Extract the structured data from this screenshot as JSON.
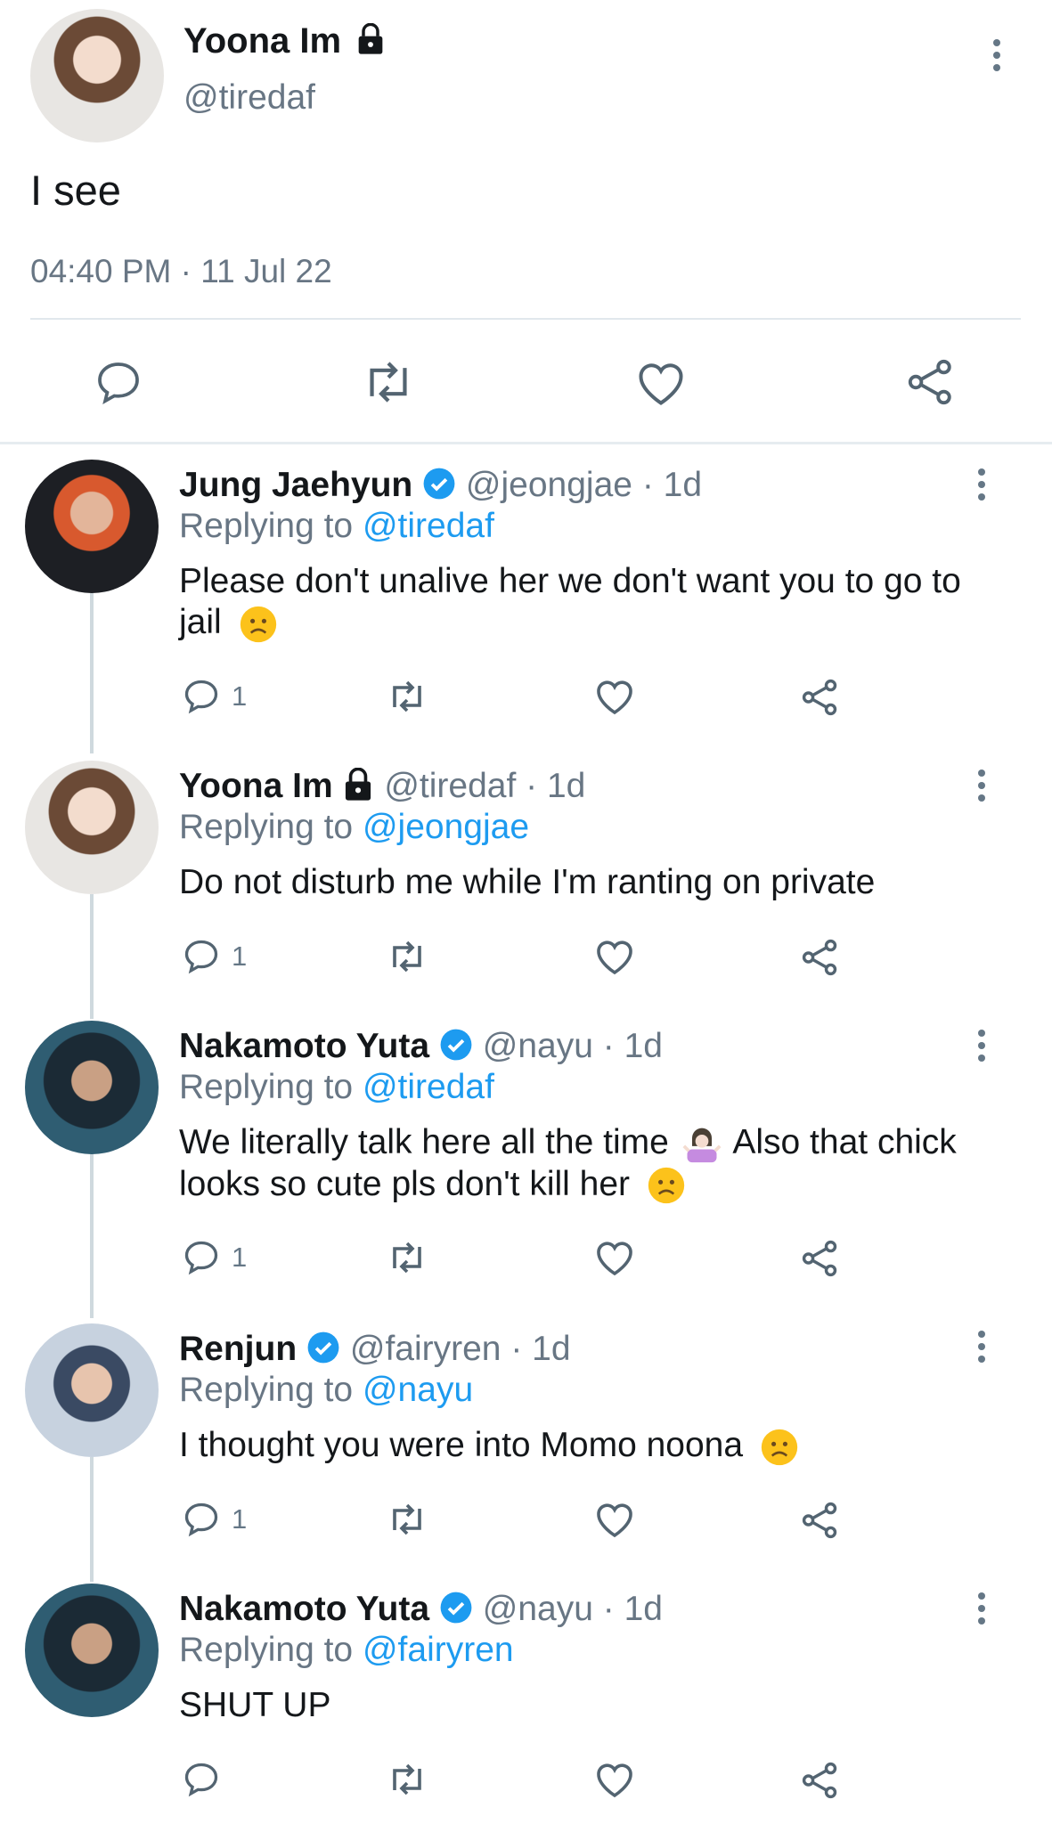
{
  "main_tweet": {
    "name": "Yoona Im",
    "handle": "@tiredaf",
    "text": "I see",
    "timestamp": "04:40 PM · 11 Jul 22",
    "locked": true
  },
  "replies": [
    {
      "name": "Jung Jaehyun",
      "verified": true,
      "handle": "@jeongjae",
      "time": "· 1d",
      "replying_label": "Replying to",
      "replying_to": "@tiredaf",
      "text_line1": "Please don't unalive her we don't want you to go to",
      "text_line2": "jail",
      "reply_count": "1"
    },
    {
      "name": "Yoona Im",
      "locked": true,
      "handle": "@tiredaf",
      "time": "· 1d",
      "replying_label": "Replying to",
      "replying_to": "@jeongjae",
      "text_line1": "Do not disturb me while I'm ranting on private",
      "reply_count": "1"
    },
    {
      "name": "Nakamoto Yuta",
      "verified": true,
      "handle": "@nayu",
      "time": "· 1d",
      "replying_label": "Replying to",
      "replying_to": "@tiredaf",
      "text_line1a": "We literally talk here all the time",
      "text_line1b": "Also that chick",
      "text_line2": "looks so cute pls don't kill her",
      "reply_count": "1"
    },
    {
      "name": "Renjun",
      "verified": true,
      "handle": "@fairyren",
      "time": "· 1d",
      "replying_label": "Replying to",
      "replying_to": "@nayu",
      "text_line1": "I thought you were into Momo noona",
      "reply_count": "1"
    },
    {
      "name": "Nakamoto Yuta",
      "verified": true,
      "handle": "@nayu",
      "time": "· 1d",
      "replying_label": "Replying to",
      "replying_to": "@fairyren",
      "text_line1": "SHUT UP",
      "reply_count": ""
    }
  ],
  "icons": {
    "reply": "reply-icon",
    "retweet": "retweet-icon",
    "like": "heart-icon",
    "share": "share-icon",
    "more": "more-vertical-icon",
    "lock": "lock-icon",
    "verified": "verified-badge-icon"
  },
  "colors": {
    "link": "#1d9bf0",
    "muted": "#687684",
    "verified": "#1d9bf0",
    "divider": "#e1e8ed"
  }
}
